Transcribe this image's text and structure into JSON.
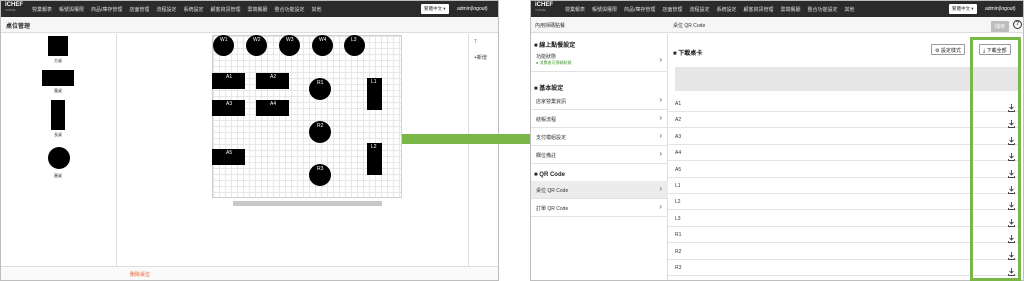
{
  "brand": {
    "name": "iCHEF",
    "sub": "Y.FPHE"
  },
  "nav_items": [
    "營業報表",
    "帳號與權限",
    "商品/庫存管理",
    "店面管理",
    "流程設定",
    "系統設定",
    "顧客資訊管理",
    "雲端餐廳",
    "整合功能設定",
    "其他"
  ],
  "nav_items_right": [
    "營業報表",
    "帳號與權限",
    "商品/庫存管理",
    "店面管理",
    "流程設定",
    "系統設定",
    "顧客資訊管理",
    "雲端餐廳",
    "整合功能設定",
    "其他"
  ],
  "language": "繁體中文",
  "user": "admin(logout)",
  "left": {
    "title": "桌位管理",
    "shapes": [
      {
        "label": "方桌"
      },
      {
        "label": "寬桌"
      },
      {
        "label": "長桌"
      },
      {
        "label": "圓桌"
      }
    ],
    "tables_top": [
      "W1",
      "W2",
      "W3",
      "W4",
      "L3"
    ],
    "tables_rect": [
      "A1",
      "A2",
      "A3",
      "A4",
      "A5"
    ],
    "tables_round": [
      "R1",
      "R2",
      "R3"
    ],
    "tables_long": [
      "L1",
      "L2"
    ],
    "side_tab": "T",
    "add_new": "+新增",
    "delete_label": "刪除桌位"
  },
  "right": {
    "sidebar_title": "內用掃碼點餐",
    "page_title": "桌位 QR Code",
    "save_label": "儲存",
    "help": "?",
    "sections": [
      {
        "title": "線上點餐設定",
        "items": [
          {
            "label": "功能狀態",
            "status": "● 消費者可掃碼點餐"
          }
        ]
      },
      {
        "title": "基本設定",
        "items": [
          {
            "label": "店家營業資訊"
          },
          {
            "label": "結帳流程"
          },
          {
            "label": "支付模組設定"
          },
          {
            "label": "欄位備註"
          }
        ]
      },
      {
        "title": "QR Code",
        "items": [
          {
            "label": "桌位 QR Code"
          },
          {
            "label": "訂單 QR Code"
          }
        ]
      }
    ],
    "download_card_title": "下載桌卡",
    "style_button": "設定樣式",
    "download_all": "下載全部",
    "tables": [
      "A1",
      "A2",
      "A3",
      "A4",
      "A5",
      "L1",
      "L2",
      "L3",
      "R1",
      "R2",
      "R3"
    ]
  },
  "colors": {
    "arrow": "#7ab648",
    "highlight": "#7ab648",
    "topbar": "#2b2b2b",
    "delete": "#e05a30"
  }
}
